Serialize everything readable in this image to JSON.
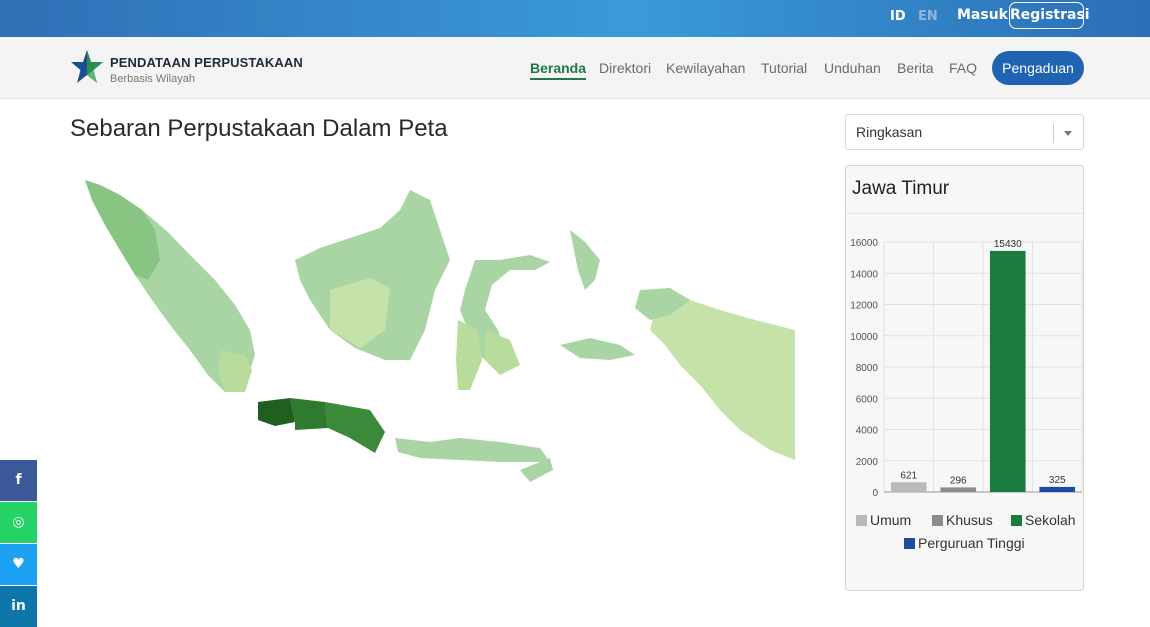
{
  "topbar": {
    "lang_id": "ID",
    "lang_en": "EN",
    "login": "Masuk",
    "register": "Registrasi"
  },
  "brand": {
    "title": "PENDATAAN PERPUSTAKAAN",
    "subtitle": "Berbasis Wilayah",
    "logo_icon": "star-icon"
  },
  "nav": {
    "items": [
      "Beranda",
      "Direktori",
      "Kewilayahan",
      "Tutorial",
      "Unduhan",
      "Berita",
      "FAQ"
    ],
    "active": "Beranda",
    "complaint_button": "Pengaduan"
  },
  "main": {
    "title": "Sebaran Perpustakaan Dalam Peta"
  },
  "sidebar": {
    "select_value": "Ringkasan",
    "panel_title": "Jawa Timur"
  },
  "chart_data": {
    "type": "bar",
    "categories": [
      "Umum",
      "Khusus",
      "Sekolah",
      "Perguruan Tinggi"
    ],
    "values": [
      621,
      296,
      15430,
      325
    ],
    "colors": [
      "#b9b9b9",
      "#8c8c8c",
      "#1b7a3e",
      "#1f4aa0"
    ],
    "ylim": [
      0,
      16000
    ],
    "yticks": [
      0,
      2000,
      4000,
      6000,
      8000,
      10000,
      12000,
      14000,
      16000
    ],
    "grid": true,
    "legend": "bottom"
  },
  "social": [
    {
      "icon": "facebook-icon",
      "glyph": "f",
      "color": "#3b5998"
    },
    {
      "icon": "whatsapp-icon",
      "glyph": "◎",
      "color": "#25d366"
    },
    {
      "icon": "twitter-icon",
      "glyph": "♥",
      "color": "#1da1f2"
    },
    {
      "icon": "linkedin-icon",
      "glyph": "in",
      "color": "#0e76a8"
    }
  ]
}
